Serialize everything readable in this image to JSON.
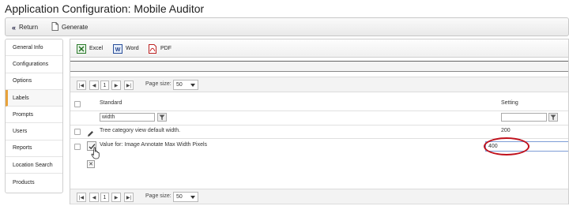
{
  "title": "Application Configuration: Mobile Auditor",
  "toolbar": {
    "return_label": "Return",
    "generate_label": "Generate"
  },
  "sidebar": {
    "items": [
      {
        "label": "General Info"
      },
      {
        "label": "Configurations"
      },
      {
        "label": "Options"
      },
      {
        "label": "Labels"
      },
      {
        "label": "Prompts"
      },
      {
        "label": "Users"
      },
      {
        "label": "Reports"
      },
      {
        "label": "Location Search"
      },
      {
        "label": "Products"
      }
    ],
    "active_index": 3
  },
  "export": {
    "excel": "Excel",
    "word": "Word",
    "pdf": "PDF"
  },
  "pager": {
    "page": "1",
    "page_size_label": "Page size:",
    "page_size": "50"
  },
  "grid": {
    "col_standard": "Standard",
    "col_setting": "Setting",
    "filter_standard": "width",
    "filter_setting": "",
    "rows": [
      {
        "standard": "Tree category view default width.",
        "setting": "200"
      },
      {
        "standard": "Value for: Image Annotate Max Width Pixels",
        "setting": "400"
      }
    ]
  },
  "colors": {
    "accent": "#e8a23a",
    "highlight": "#c0111c",
    "edit_border": "#7d9dd6"
  }
}
